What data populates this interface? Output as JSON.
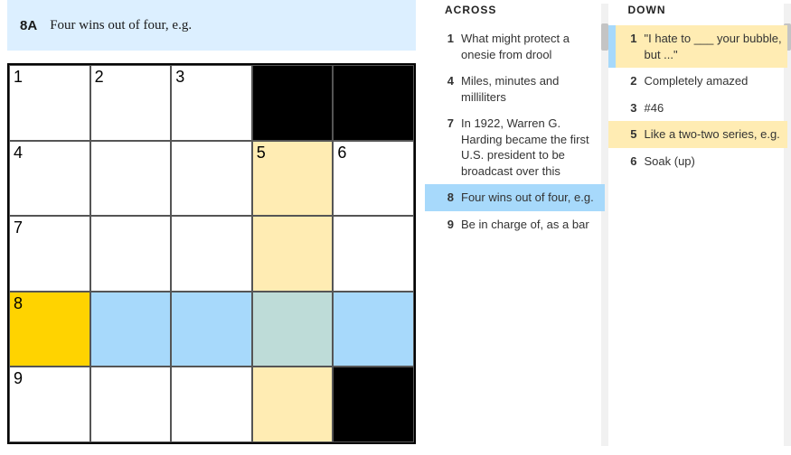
{
  "current_clue": {
    "label": "8A",
    "text": "Four wins out of four, e.g."
  },
  "grid": [
    [
      {
        "n": "1",
        "t": "w"
      },
      {
        "n": "2",
        "t": "w"
      },
      {
        "n": "3",
        "t": "w"
      },
      {
        "t": "b"
      },
      {
        "t": "b"
      }
    ],
    [
      {
        "n": "4",
        "t": "w"
      },
      {
        "t": "w"
      },
      {
        "t": "w"
      },
      {
        "n": "5",
        "t": "d"
      },
      {
        "n": "6",
        "t": "w"
      }
    ],
    [
      {
        "n": "7",
        "t": "w"
      },
      {
        "t": "w"
      },
      {
        "t": "w"
      },
      {
        "t": "d"
      },
      {
        "t": "w"
      }
    ],
    [
      {
        "n": "8",
        "t": "f"
      },
      {
        "t": "a"
      },
      {
        "t": "a"
      },
      {
        "t": "x"
      },
      {
        "t": "a"
      }
    ],
    [
      {
        "n": "9",
        "t": "w"
      },
      {
        "t": "w"
      },
      {
        "t": "w"
      },
      {
        "t": "d"
      },
      {
        "t": "b"
      }
    ]
  ],
  "across": {
    "title": "ACROSS",
    "clues": [
      {
        "n": "1",
        "t": "What might protect a onesie from drool"
      },
      {
        "n": "4",
        "t": "Miles, minutes and milliliters"
      },
      {
        "n": "7",
        "t": "In 1922, Warren G. Harding became the first U.S. president to be broadcast over this"
      },
      {
        "n": "8",
        "t": "Four wins out of four, e.g.",
        "state": "active"
      },
      {
        "n": "9",
        "t": "Be in charge of, as a bar"
      }
    ]
  },
  "down": {
    "title": "DOWN",
    "clues": [
      {
        "n": "1",
        "t": "\"I hate to ___ your bubble, but ...\"",
        "state": "secondary"
      },
      {
        "n": "2",
        "t": "Completely amazed"
      },
      {
        "n": "3",
        "t": "#46"
      },
      {
        "n": "5",
        "t": "Like a two-two series, e.g.",
        "state": "secondary-plain"
      },
      {
        "n": "6",
        "t": "Soak (up)"
      }
    ]
  }
}
